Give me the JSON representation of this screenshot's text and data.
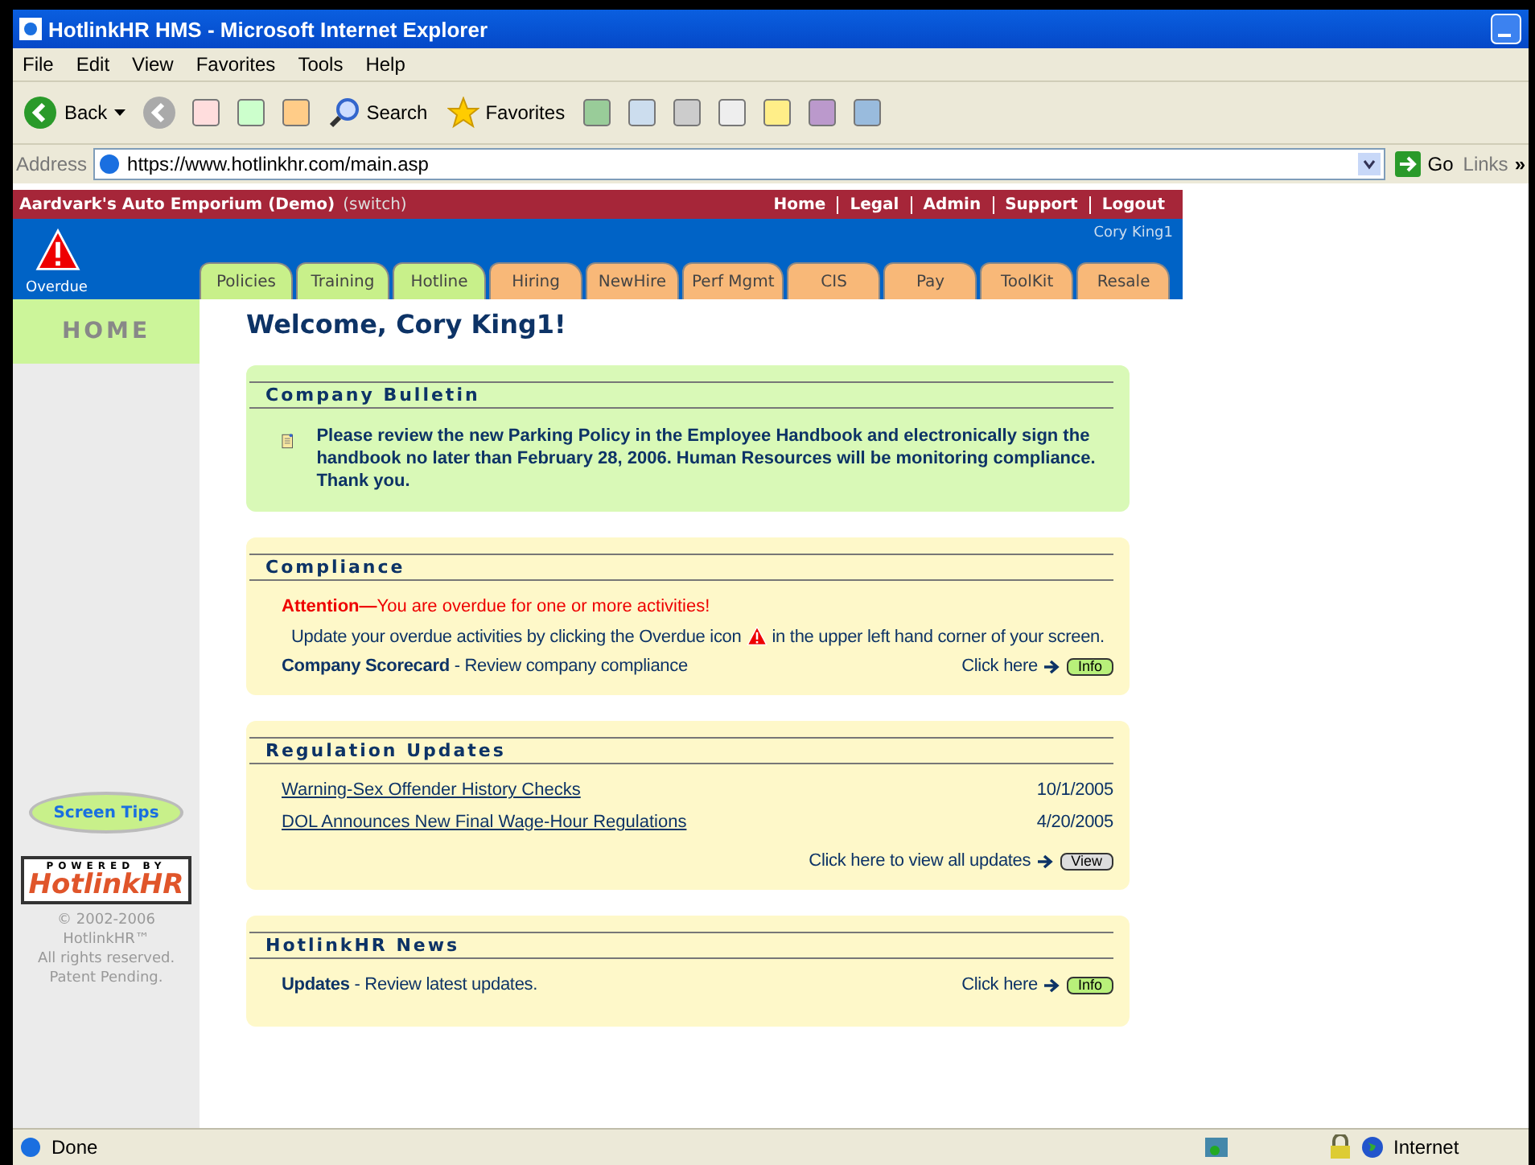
{
  "window": {
    "title": "HotlinkHR HMS - Microsoft Internet Explorer"
  },
  "menu": [
    "File",
    "Edit",
    "View",
    "Favorites",
    "Tools",
    "Help"
  ],
  "toolbar": {
    "back": "Back",
    "search": "Search",
    "favorites": "Favorites"
  },
  "address": {
    "label": "Address",
    "value": "https://www.hotlinkhr.com/main.asp",
    "go": "Go",
    "links": "Links",
    "more": "»"
  },
  "site": {
    "company": "Aardvark's Auto Emporium (Demo)",
    "switch": "(switch)",
    "nav": [
      "Home",
      "Legal",
      "Admin",
      "Support",
      "Logout"
    ],
    "user": "Cory King1",
    "overdue": "Overdue",
    "tabs": [
      {
        "label": "Policies",
        "color": "#c8f08a"
      },
      {
        "label": "Training",
        "color": "#c8f08a"
      },
      {
        "label": "Hotline",
        "color": "#c8f08a"
      },
      {
        "label": "Hiring",
        "color": "#f8b878"
      },
      {
        "label": "NewHire",
        "color": "#f8b878"
      },
      {
        "label": "Perf Mgmt",
        "color": "#f8b878"
      },
      {
        "label": "CIS",
        "color": "#f8b878"
      },
      {
        "label": "Pay",
        "color": "#f8b878"
      },
      {
        "label": "ToolKit",
        "color": "#f8b878"
      },
      {
        "label": "Resale",
        "color": "#f8b878"
      }
    ]
  },
  "sidebar": {
    "heading": "HOME",
    "screen_tips": "Screen Tips",
    "powered_by": "POWERED BY",
    "logo": "HotlinkHR",
    "copyright": [
      "© 2002-2006",
      "HotlinkHR™",
      "All rights reserved.",
      "Patent Pending."
    ]
  },
  "welcome": "Welcome, Cory King1!",
  "bulletin": {
    "title": "Company Bulletin",
    "text": "Please review the new Parking Policy in the Employee Handbook and electronically sign the handbook no later than February 28, 2006. Human Resources will be monitoring compliance. Thank you."
  },
  "compliance": {
    "title": "Compliance",
    "attention": "**Attention—**You are overdue for one or more activities!",
    "instruction_before": "Update your overdue activities by clicking the Overdue icon",
    "instruction_after": "in the upper left hand corner of your screen.",
    "scorecard": "**Company Scorecard** - Review company compliance",
    "click": "Click here",
    "button": "Info"
  },
  "regulations": {
    "title": "Regulation Updates",
    "items": [
      {
        "title": "Warning-Sex Offender History Checks",
        "date": "10/1/2005"
      },
      {
        "title": "DOL Announces New Final Wage-Hour Regulations",
        "date": "4/20/2005"
      }
    ],
    "click": "Click here to view all updates",
    "button": "View"
  },
  "news": {
    "title": "HotlinkHR News",
    "text": "**Updates** - Review latest updates.",
    "click": "Click here",
    "button": "Info"
  },
  "status": {
    "text": "Done",
    "zone": "Internet"
  }
}
